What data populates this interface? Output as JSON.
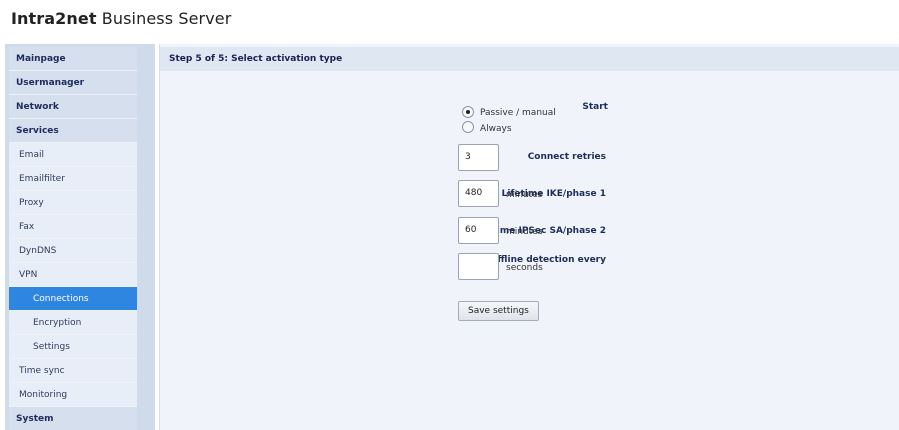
{
  "header": {
    "brand_bold": "Intra2net",
    "brand_rest": " Business Server"
  },
  "sidebar": {
    "items": [
      {
        "label": "Mainpage"
      },
      {
        "label": "Usermanager"
      },
      {
        "label": "Network"
      },
      {
        "label": "Services"
      },
      {
        "label": "Email"
      },
      {
        "label": "Emailfilter"
      },
      {
        "label": "Proxy"
      },
      {
        "label": "Fax"
      },
      {
        "label": "DynDNS"
      },
      {
        "label": "VPN"
      },
      {
        "label": "Connections",
        "active": true
      },
      {
        "label": "Encryption"
      },
      {
        "label": "Settings"
      },
      {
        "label": "Time sync"
      },
      {
        "label": "Monitoring"
      },
      {
        "label": "System"
      }
    ]
  },
  "main": {
    "title": "Step 5 of 5: Select activation type",
    "start": {
      "label": "Start",
      "options": [
        "Passive / manual",
        "Always"
      ],
      "selected": "Passive / manual"
    },
    "connect_retries": {
      "label": "Connect retries",
      "value": "3"
    },
    "lifetime_ike": {
      "label": "Lifetime IKE/phase 1",
      "value": "480",
      "unit": "minutes"
    },
    "lifetime_ipsec": {
      "label": "Lifetime IPSec SA/phase 2",
      "value": "60",
      "unit": "minutes"
    },
    "offline_detection": {
      "label": "Offline detection every",
      "value": "",
      "unit": "seconds"
    },
    "save_label": "Save settings"
  }
}
